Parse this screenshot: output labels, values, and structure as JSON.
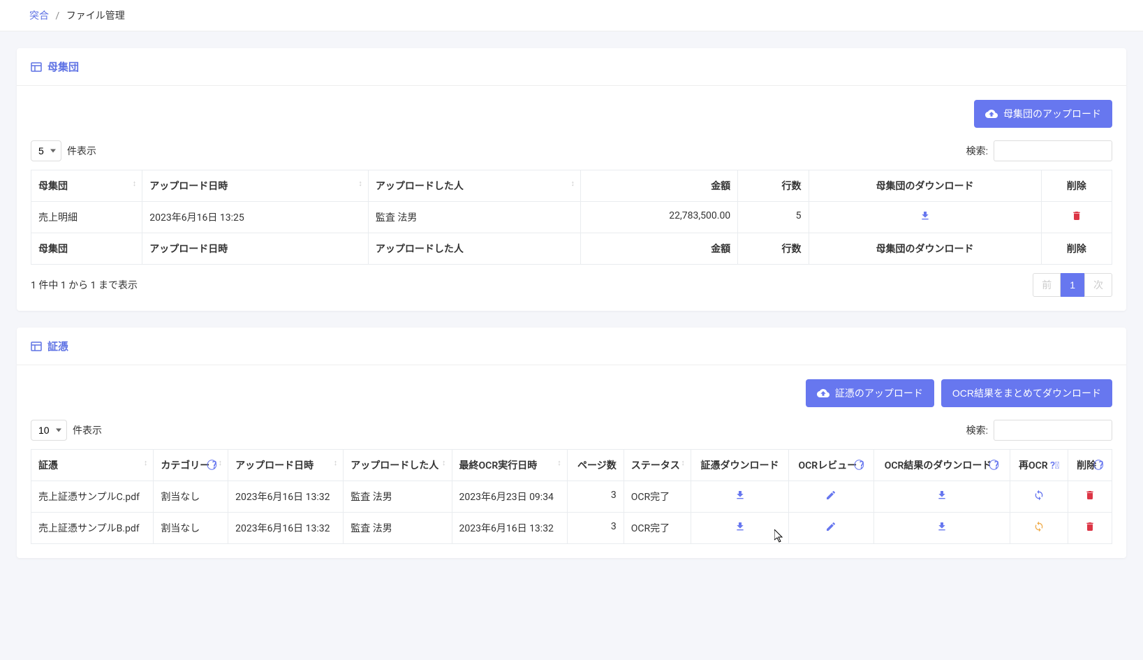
{
  "breadcrumb": {
    "root": "突合",
    "current": "ファイル管理"
  },
  "population": {
    "title": "母集団",
    "upload_btn": "母集団のアップロード",
    "length": "件表示",
    "length_value": "5",
    "search": "検索:",
    "headers": {
      "name": "母集団",
      "uploaded_at": "アップロード日時",
      "uploaded_by": "アップロードした人",
      "amount": "金額",
      "rows": "行数",
      "download": "母集団のダウンロード",
      "delete": "削除"
    },
    "rows": [
      {
        "name": "売上明細",
        "uploaded_at": "2023年6月16日 13:25",
        "uploaded_by": "監査 法男",
        "amount": "22,783,500.00",
        "rowcount": "5"
      }
    ],
    "info": "1 件中 1 から 1 まで表示",
    "pagination": {
      "prev": "前",
      "page": "1",
      "next": "次"
    }
  },
  "evidence": {
    "title": "証憑",
    "upload_btn": "証憑のアップロード",
    "download_all_btn": "OCR結果をまとめてダウンロード",
    "length": "件表示",
    "length_value": "10",
    "search": "検索:",
    "headers": {
      "name": "証憑",
      "category": "カテゴリー",
      "uploaded_at": "アップロード日時",
      "uploaded_by": "アップロードした人",
      "last_ocr": "最終OCR実行日時",
      "pages": "ページ数",
      "status": "ステータス",
      "download": "証憑ダウンロード",
      "ocr_review": "OCRレビュー",
      "ocr_dl": "OCR結果のダウンロード",
      "reocr": "再OCR",
      "delete": "削除"
    },
    "rows": [
      {
        "name": "売上証憑サンプルC.pdf",
        "category": "割当なし",
        "uploaded_at": "2023年6月16日 13:32",
        "uploaded_by": "監査 法男",
        "last_ocr": "2023年6月23日 09:34",
        "pages": "3",
        "status": "OCR完了",
        "reocr_variant": "blue"
      },
      {
        "name": "売上証憑サンプルB.pdf",
        "category": "割当なし",
        "uploaded_at": "2023年6月16日 13:32",
        "uploaded_by": "監査 法男",
        "last_ocr": "2023年6月16日 13:32",
        "pages": "3",
        "status": "OCR完了",
        "reocr_variant": "warn"
      }
    ]
  }
}
